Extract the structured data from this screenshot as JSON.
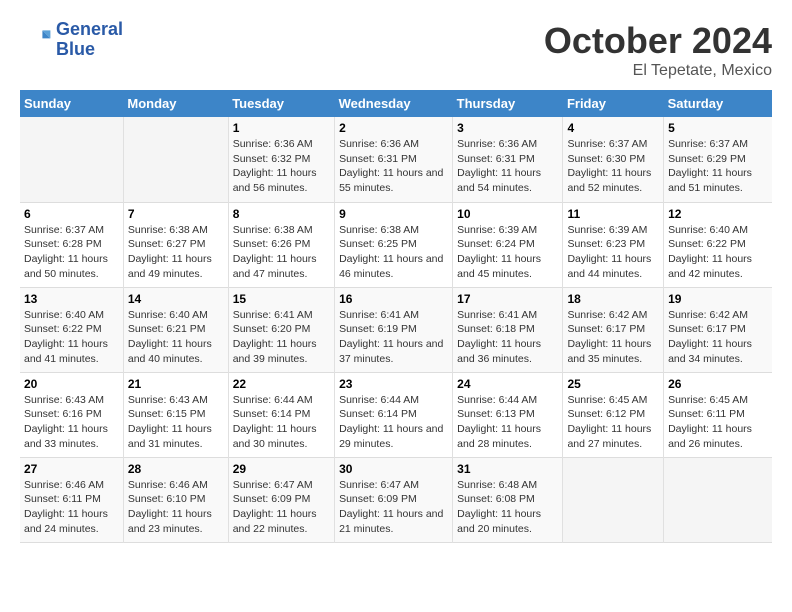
{
  "logo": {
    "line1": "General",
    "line2": "Blue"
  },
  "title": "October 2024",
  "location": "El Tepetate, Mexico",
  "days_of_week": [
    "Sunday",
    "Monday",
    "Tuesday",
    "Wednesday",
    "Thursday",
    "Friday",
    "Saturday"
  ],
  "weeks": [
    [
      {
        "day": "",
        "sunrise": "",
        "sunset": "",
        "daylight": ""
      },
      {
        "day": "",
        "sunrise": "",
        "sunset": "",
        "daylight": ""
      },
      {
        "day": "1",
        "sunrise": "Sunrise: 6:36 AM",
        "sunset": "Sunset: 6:32 PM",
        "daylight": "Daylight: 11 hours and 56 minutes."
      },
      {
        "day": "2",
        "sunrise": "Sunrise: 6:36 AM",
        "sunset": "Sunset: 6:31 PM",
        "daylight": "Daylight: 11 hours and 55 minutes."
      },
      {
        "day": "3",
        "sunrise": "Sunrise: 6:36 AM",
        "sunset": "Sunset: 6:31 PM",
        "daylight": "Daylight: 11 hours and 54 minutes."
      },
      {
        "day": "4",
        "sunrise": "Sunrise: 6:37 AM",
        "sunset": "Sunset: 6:30 PM",
        "daylight": "Daylight: 11 hours and 52 minutes."
      },
      {
        "day": "5",
        "sunrise": "Sunrise: 6:37 AM",
        "sunset": "Sunset: 6:29 PM",
        "daylight": "Daylight: 11 hours and 51 minutes."
      }
    ],
    [
      {
        "day": "6",
        "sunrise": "Sunrise: 6:37 AM",
        "sunset": "Sunset: 6:28 PM",
        "daylight": "Daylight: 11 hours and 50 minutes."
      },
      {
        "day": "7",
        "sunrise": "Sunrise: 6:38 AM",
        "sunset": "Sunset: 6:27 PM",
        "daylight": "Daylight: 11 hours and 49 minutes."
      },
      {
        "day": "8",
        "sunrise": "Sunrise: 6:38 AM",
        "sunset": "Sunset: 6:26 PM",
        "daylight": "Daylight: 11 hours and 47 minutes."
      },
      {
        "day": "9",
        "sunrise": "Sunrise: 6:38 AM",
        "sunset": "Sunset: 6:25 PM",
        "daylight": "Daylight: 11 hours and 46 minutes."
      },
      {
        "day": "10",
        "sunrise": "Sunrise: 6:39 AM",
        "sunset": "Sunset: 6:24 PM",
        "daylight": "Daylight: 11 hours and 45 minutes."
      },
      {
        "day": "11",
        "sunrise": "Sunrise: 6:39 AM",
        "sunset": "Sunset: 6:23 PM",
        "daylight": "Daylight: 11 hours and 44 minutes."
      },
      {
        "day": "12",
        "sunrise": "Sunrise: 6:40 AM",
        "sunset": "Sunset: 6:22 PM",
        "daylight": "Daylight: 11 hours and 42 minutes."
      }
    ],
    [
      {
        "day": "13",
        "sunrise": "Sunrise: 6:40 AM",
        "sunset": "Sunset: 6:22 PM",
        "daylight": "Daylight: 11 hours and 41 minutes."
      },
      {
        "day": "14",
        "sunrise": "Sunrise: 6:40 AM",
        "sunset": "Sunset: 6:21 PM",
        "daylight": "Daylight: 11 hours and 40 minutes."
      },
      {
        "day": "15",
        "sunrise": "Sunrise: 6:41 AM",
        "sunset": "Sunset: 6:20 PM",
        "daylight": "Daylight: 11 hours and 39 minutes."
      },
      {
        "day": "16",
        "sunrise": "Sunrise: 6:41 AM",
        "sunset": "Sunset: 6:19 PM",
        "daylight": "Daylight: 11 hours and 37 minutes."
      },
      {
        "day": "17",
        "sunrise": "Sunrise: 6:41 AM",
        "sunset": "Sunset: 6:18 PM",
        "daylight": "Daylight: 11 hours and 36 minutes."
      },
      {
        "day": "18",
        "sunrise": "Sunrise: 6:42 AM",
        "sunset": "Sunset: 6:17 PM",
        "daylight": "Daylight: 11 hours and 35 minutes."
      },
      {
        "day": "19",
        "sunrise": "Sunrise: 6:42 AM",
        "sunset": "Sunset: 6:17 PM",
        "daylight": "Daylight: 11 hours and 34 minutes."
      }
    ],
    [
      {
        "day": "20",
        "sunrise": "Sunrise: 6:43 AM",
        "sunset": "Sunset: 6:16 PM",
        "daylight": "Daylight: 11 hours and 33 minutes."
      },
      {
        "day": "21",
        "sunrise": "Sunrise: 6:43 AM",
        "sunset": "Sunset: 6:15 PM",
        "daylight": "Daylight: 11 hours and 31 minutes."
      },
      {
        "day": "22",
        "sunrise": "Sunrise: 6:44 AM",
        "sunset": "Sunset: 6:14 PM",
        "daylight": "Daylight: 11 hours and 30 minutes."
      },
      {
        "day": "23",
        "sunrise": "Sunrise: 6:44 AM",
        "sunset": "Sunset: 6:14 PM",
        "daylight": "Daylight: 11 hours and 29 minutes."
      },
      {
        "day": "24",
        "sunrise": "Sunrise: 6:44 AM",
        "sunset": "Sunset: 6:13 PM",
        "daylight": "Daylight: 11 hours and 28 minutes."
      },
      {
        "day": "25",
        "sunrise": "Sunrise: 6:45 AM",
        "sunset": "Sunset: 6:12 PM",
        "daylight": "Daylight: 11 hours and 27 minutes."
      },
      {
        "day": "26",
        "sunrise": "Sunrise: 6:45 AM",
        "sunset": "Sunset: 6:11 PM",
        "daylight": "Daylight: 11 hours and 26 minutes."
      }
    ],
    [
      {
        "day": "27",
        "sunrise": "Sunrise: 6:46 AM",
        "sunset": "Sunset: 6:11 PM",
        "daylight": "Daylight: 11 hours and 24 minutes."
      },
      {
        "day": "28",
        "sunrise": "Sunrise: 6:46 AM",
        "sunset": "Sunset: 6:10 PM",
        "daylight": "Daylight: 11 hours and 23 minutes."
      },
      {
        "day": "29",
        "sunrise": "Sunrise: 6:47 AM",
        "sunset": "Sunset: 6:09 PM",
        "daylight": "Daylight: 11 hours and 22 minutes."
      },
      {
        "day": "30",
        "sunrise": "Sunrise: 6:47 AM",
        "sunset": "Sunset: 6:09 PM",
        "daylight": "Daylight: 11 hours and 21 minutes."
      },
      {
        "day": "31",
        "sunrise": "Sunrise: 6:48 AM",
        "sunset": "Sunset: 6:08 PM",
        "daylight": "Daylight: 11 hours and 20 minutes."
      },
      {
        "day": "",
        "sunrise": "",
        "sunset": "",
        "daylight": ""
      },
      {
        "day": "",
        "sunrise": "",
        "sunset": "",
        "daylight": ""
      }
    ]
  ]
}
